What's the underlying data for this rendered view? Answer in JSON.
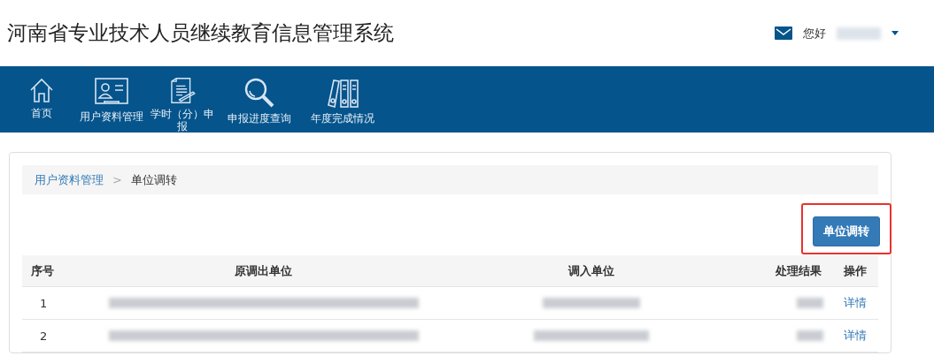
{
  "header": {
    "title": "河南省专业技术人员继续教育信息管理系统",
    "greeting": "您好"
  },
  "nav": [
    {
      "label": "首页"
    },
    {
      "label": "用户资料管理"
    },
    {
      "label": "学时（分）申报"
    },
    {
      "label": "申报进度查询"
    },
    {
      "label": "年度完成情况"
    }
  ],
  "breadcrumb": [
    {
      "label": "用户资料管理",
      "kind": "link"
    },
    {
      "label": ">",
      "kind": "separator"
    },
    {
      "label": "单位调转",
      "kind": "current"
    }
  ],
  "action_button": {
    "label": "单位调转",
    "highlighted": true
  },
  "table": {
    "columns": [
      "序号",
      "原调出单位",
      "调入单位",
      "处理结果",
      "操作"
    ],
    "rows": [
      {
        "index": "1",
        "action": "详情"
      },
      {
        "index": "2",
        "action": "详情"
      }
    ]
  }
}
